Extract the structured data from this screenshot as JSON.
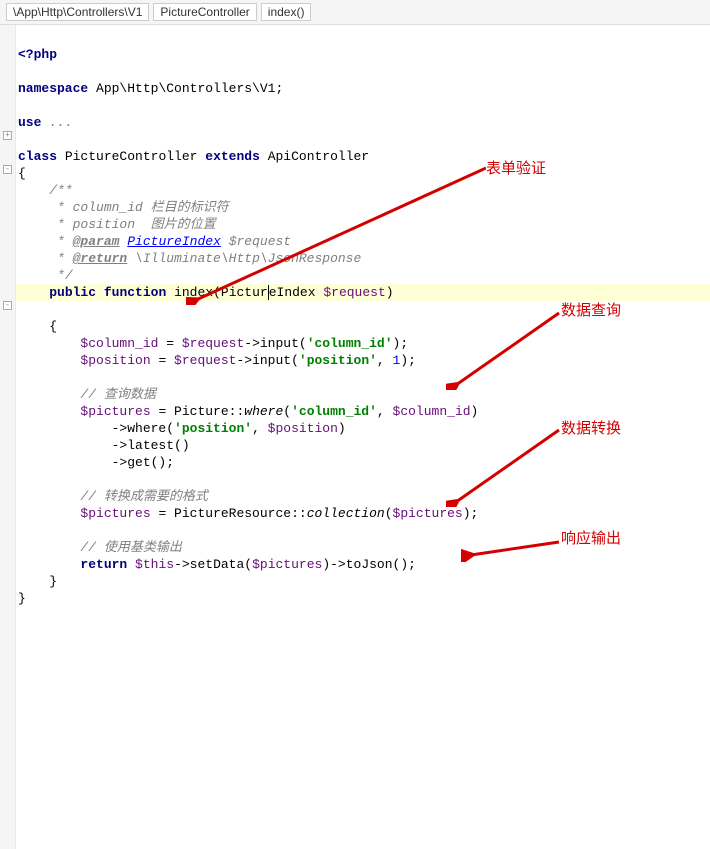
{
  "breadcrumb": {
    "path": "\\App\\Http\\Controllers\\V1",
    "class": "PictureController",
    "method": "index()"
  },
  "code": {
    "open_tag": "<?php",
    "namespace_kw": "namespace",
    "namespace_val": "App\\Http\\Controllers\\V1;",
    "use_kw": "use",
    "use_val": "...",
    "class_kw": "class",
    "class_name": "PictureController",
    "extends_kw": "extends",
    "parent_name": "ApiController",
    "doc_start": "/**",
    "doc_column": " * column_id 栏目的标识符",
    "doc_position": " * position  图片的位置",
    "doc_param_tag": "@param",
    "doc_param_type": "PictureIndex",
    "doc_param_var": "$request",
    "doc_return_tag": "@return",
    "doc_return_type": "\\Illuminate\\Http\\JsonResponse",
    "doc_end": " */",
    "fn_public": "public",
    "fn_function": "function",
    "fn_name": "index",
    "fn_param_type": "PictureIndex",
    "fn_param_var": "$request",
    "var_column": "$column_id",
    "var_request": "$request",
    "method_input": "input",
    "str_column": "'column_id'",
    "var_position": "$position",
    "str_position": "'position'",
    "num_one": "1",
    "com_query": "// 查询数据",
    "var_pictures": "$pictures",
    "cls_picture": "Picture",
    "method_where": "where",
    "method_latest": "latest",
    "method_get": "get",
    "com_transform": "// 转换成需要的格式",
    "cls_resource": "PictureResource",
    "method_collection": "collection",
    "com_output": "// 使用基类输出",
    "return_kw": "return",
    "var_this": "$this",
    "method_setdata": "setData",
    "method_tojson": "toJson"
  },
  "annotations": {
    "a1": "表单验证",
    "a2": "数据查询",
    "a3": "数据转换",
    "a4": "响应输出"
  }
}
